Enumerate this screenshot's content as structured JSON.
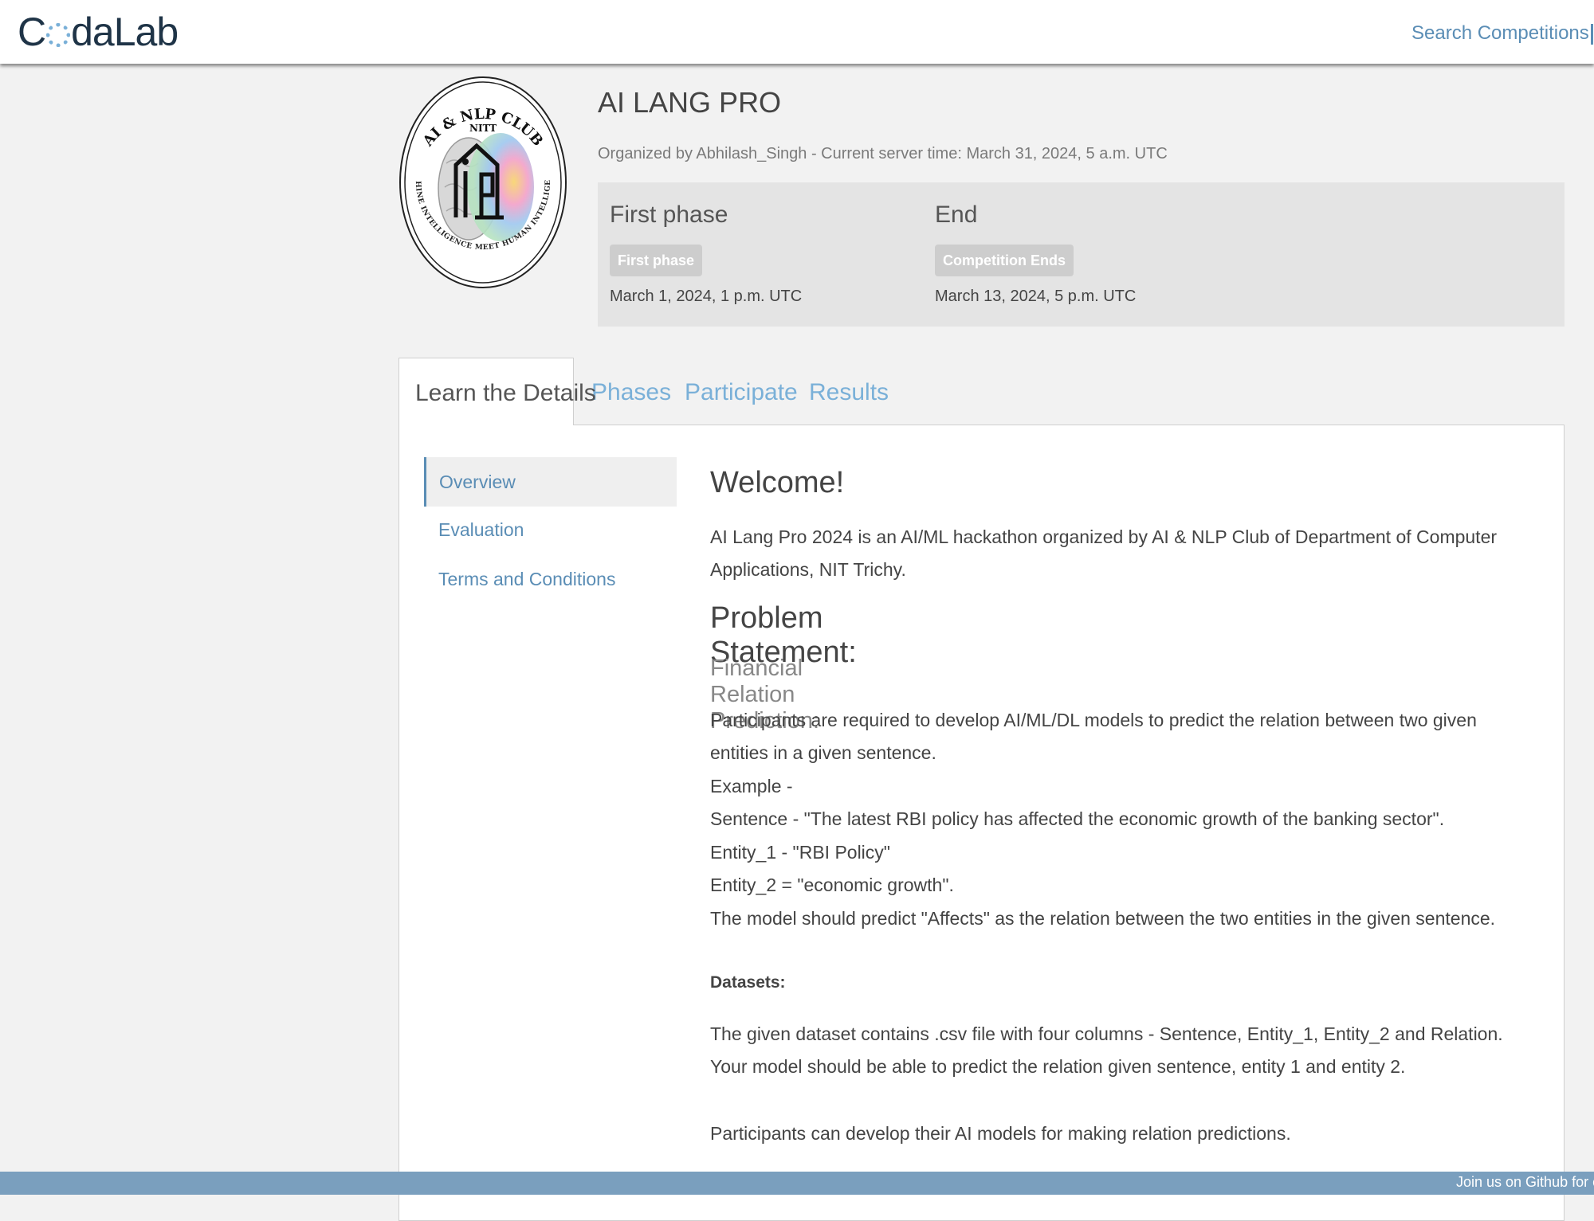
{
  "brand": {
    "name_prefix": "C",
    "name_suffix": "daLab"
  },
  "nav": {
    "search_link": "Search Competitions"
  },
  "competition": {
    "title": "AI LANG PRO",
    "organizer_line": "Organized by Abhilash_Singh - Current server time: March 31, 2024, 5 a.m. UTC",
    "logo": {
      "top_text": "AI & NLP CLUB",
      "sub_text": "NITT",
      "ring_text": "MACHINE INTELLIGENCE MEET HUMAN INTELLIGENCE",
      "icon": "brain-building-logo-icon"
    },
    "phases": [
      {
        "name": "First phase",
        "label": "First phase",
        "date": "March 1, 2024, 1 p.m. UTC"
      },
      {
        "name": "End",
        "label": "Competition Ends",
        "date": "March 13, 2024, 5 p.m. UTC"
      }
    ]
  },
  "tabs": [
    "Learn the Details",
    "Phases",
    "Participate",
    "Results"
  ],
  "side_nav": [
    "Overview",
    "Evaluation",
    "Terms and Conditions"
  ],
  "content": {
    "welcome": "Welcome!",
    "intro": "AI Lang Pro 2024 is an AI/ML hackathon organized by AI & NLP Club of Department of Computer Applications, NIT Trichy.",
    "problem_heading": "Problem Statement:",
    "problem_subheading": "Financial Relation Prediction:",
    "problem_body": "Participants are required to develop AI/ML/DL models to predict the relation between two given entities in a given sentence.",
    "example_label": "Example -",
    "example_sentence": "Sentence - \"The latest RBI policy has affected the economic growth of the banking sector\".",
    "example_entity1": "Entity_1 - \"RBI Policy\"",
    "example_entity2": "Entity_2 = \"economic growth\".",
    "example_result": "The model should predict \"Affects\" as the relation between the two entities in the given sentence.",
    "datasets_heading": "Datasets:",
    "datasets_body": "The given dataset contains .csv file with four columns - Sentence, Entity_1, Entity_2 and Relation. Your model should be able to predict the relation given sentence, entity 1 and entity 2.",
    "closing": "Participants can develop their AI models for making relation predictions."
  },
  "footer": {
    "text": "Join us on Github for co"
  },
  "colors": {
    "link": "#5a8db5",
    "footer_bg": "#7a9fbe",
    "phase_bg": "#e4e4e4",
    "label_bg": "#cdcdcd"
  }
}
